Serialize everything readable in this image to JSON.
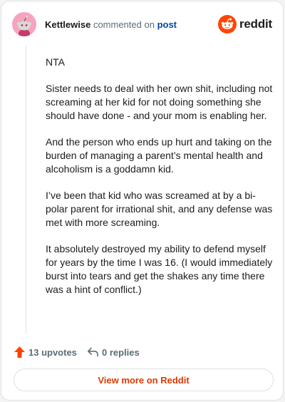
{
  "header": {
    "author": "Kettlewise",
    "action_text": "commented on",
    "post_link": "post",
    "brand": "reddit"
  },
  "icons": {
    "avatar": "snoo-avatar-icon",
    "brand_logo": "reddit-logo-icon",
    "upvote": "upvote-arrow-icon",
    "reply": "reply-icon"
  },
  "comment": {
    "paragraphs": [
      "NTA",
      "Sister needs to deal with her own shit, including not screaming at her kid for not doing something she should have done - and your mom is enabling her.",
      "And the person who ends up hurt and taking on the burden of managing a parent’s mental health and alcoholism is a goddamn kid.",
      "I’ve been that kid who was screamed at by a bi-polar parent for irrational shit, and any defense was met with more screaming.",
      "It absolutely destroyed my ability to defend myself for years by the time I was 16. (I would immediately burst into tears and get the shakes any time there was a hint of conflict.)"
    ]
  },
  "actions": {
    "upvotes": "13 upvotes",
    "replies": "0 replies"
  },
  "footer": {
    "view_more": "View more on Reddit"
  },
  "colors": {
    "brand_orange": "#ff4500",
    "link_blue": "#0045ac",
    "cta_text": "#d93a00",
    "avatar_bg": "#f6a4bd"
  }
}
